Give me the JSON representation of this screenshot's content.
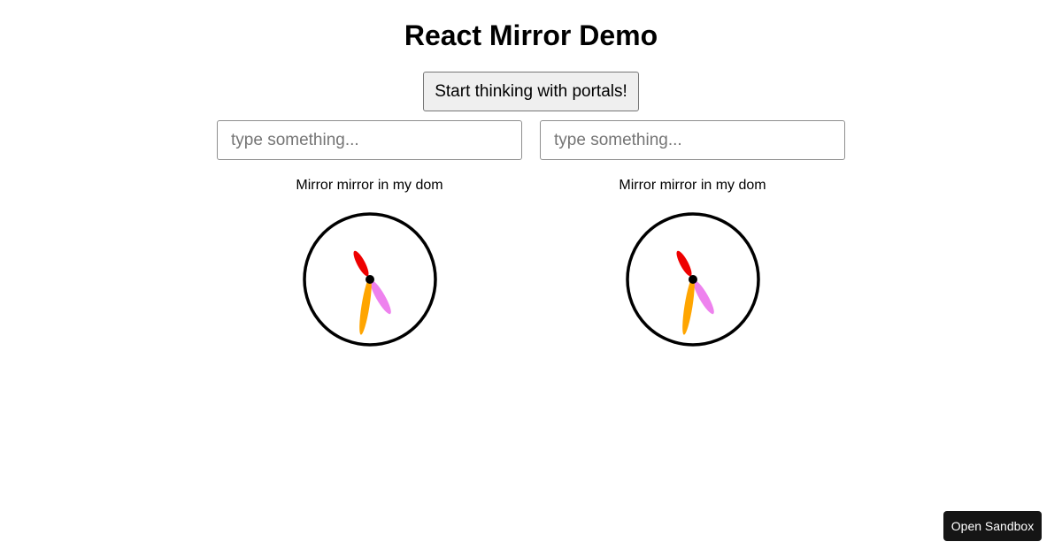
{
  "header": {
    "title": "React Mirror Demo"
  },
  "actions": {
    "portal_button_label": "Start thinking with portals!"
  },
  "inputs": {
    "left": {
      "value": "",
      "placeholder": "type something..."
    },
    "right": {
      "value": "",
      "placeholder": "type something..."
    }
  },
  "mirrors": [
    {
      "caption": "Mirror mirror in my dom"
    },
    {
      "caption": "Mirror mirror in my dom"
    }
  ],
  "clock": {
    "icon": "analog-clock-icon",
    "colors": {
      "face_stroke": "#000000",
      "hour_hand": "#ee0000",
      "minute_hand": "#ffa500",
      "second_hand": "#ee82ee",
      "center": "#000000"
    }
  },
  "footer": {
    "sandbox_label": "Open Sandbox"
  }
}
